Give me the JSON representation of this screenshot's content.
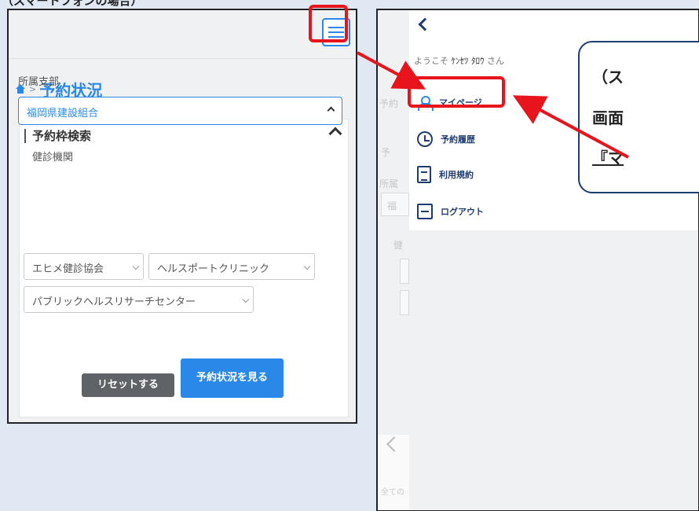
{
  "caption": "（スマートフォンの場合）",
  "left_screen": {
    "breadcrumb": {
      "separator": ">",
      "title": "予約状況"
    },
    "panel": {
      "title": "予約枠検索",
      "branch_label": "所属支部",
      "branch_value": "福岡県建設組合",
      "institution_label": "健診機関",
      "institutions": [
        "エヒメ健診協会",
        "ヘルスポートクリニック",
        "パブリックヘルスリサーチセンター"
      ],
      "reset_button": "リセットする",
      "view_button": "予約状況を見る"
    }
  },
  "right_screen": {
    "welcome_prefix": "ようこそ",
    "user_name": "ｹﾝｾﾂ ﾀﾛｳ",
    "welcome_suffix": "さん",
    "menu": [
      "マイページ",
      "予約履歴",
      "利用規約",
      "ログアウト"
    ],
    "ghost": {
      "bc": "予約",
      "p": "予",
      "label": "所属",
      "field": "福",
      "inst": "健",
      "footer": "全ての"
    }
  },
  "callout": {
    "line1": "（ス",
    "line2": "画面",
    "line3": "『マ"
  },
  "colors": {
    "accent": "#2a89e8",
    "annotation": "#e8141c",
    "navy": "#1e3c72"
  }
}
